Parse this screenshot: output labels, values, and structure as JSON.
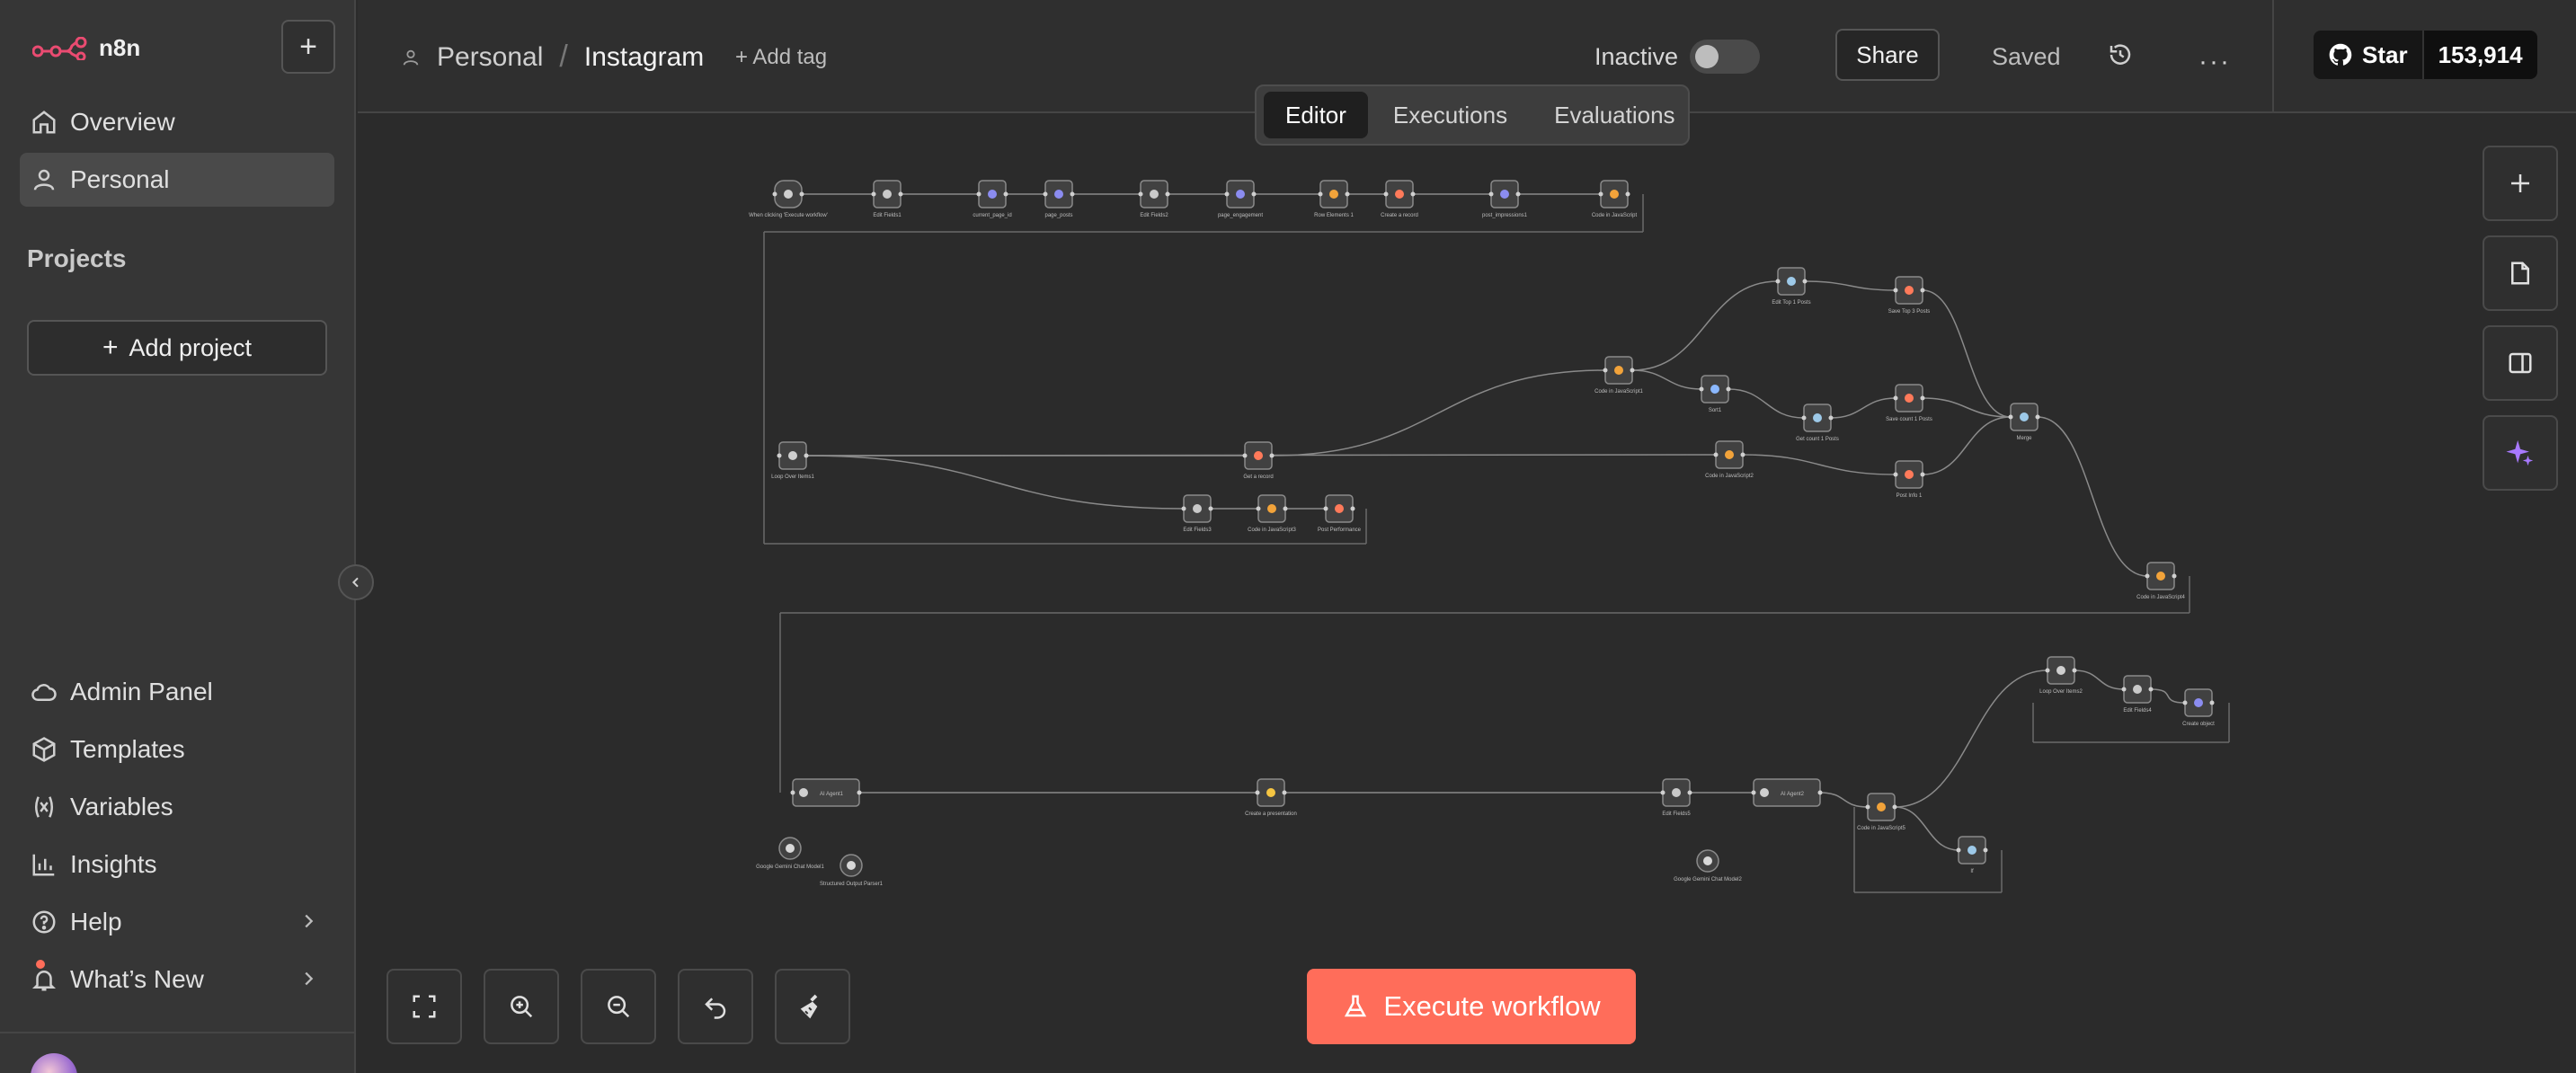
{
  "sidebar": {
    "brand": "n8n",
    "nav": [
      {
        "label": "Overview",
        "icon": "home-icon"
      },
      {
        "label": "Personal",
        "icon": "user-icon"
      }
    ],
    "projects_label": "Projects",
    "add_project_label": "Add project",
    "bottom_nav": [
      {
        "label": "Admin Panel",
        "icon": "cloud-icon"
      },
      {
        "label": "Templates",
        "icon": "box-icon"
      },
      {
        "label": "Variables",
        "icon": "variables-icon"
      },
      {
        "label": "Insights",
        "icon": "chart-icon"
      },
      {
        "label": "Help",
        "icon": "help-icon"
      },
      {
        "label": "What’s New",
        "icon": "bell-icon"
      }
    ]
  },
  "header": {
    "breadcrumb_project": "Personal",
    "breadcrumb_sep": "/",
    "workflow_name": "Instagram",
    "add_tag": "+ Add tag",
    "status_label": "Inactive",
    "share_label": "Share",
    "saved_label": "Saved",
    "github_star": "Star",
    "github_count": "153,914"
  },
  "tabs": [
    "Editor",
    "Executions",
    "Evaluations"
  ],
  "execute_label": "Execute workflow",
  "colors": {
    "accent": "#ff6d5a",
    "sidebar_bg": "#363636",
    "canvas_bg": "#2b2b2b"
  },
  "canvas": {
    "node_labels": [
      "When clicking 'Execute workflow'",
      "Edit Fields1",
      "current_page_id",
      "page_posts",
      "Edit Fields2",
      "page_engagement",
      "Row Elements 1",
      "Create a record",
      "post_impressions1",
      "Code in JavaScript",
      "Edit Top 1 Posts",
      "Save Top 3 Posts",
      "Code in JavaScript1",
      "Sort1",
      "Get count 1 Posts",
      "Save count 1 Posts",
      "Merge",
      "Loop Over Items1",
      "Get a record",
      "Code in JavaScript2",
      "Post Info 1",
      "Edit Fields3",
      "Code in JavaScript3",
      "Post Performance",
      "Code in JavaScript4",
      "Loop Over Items2",
      "Edit Fields4",
      "Create object",
      "AI Agent1",
      "Google Gemini Chat Model1",
      "Structured Output Parser1",
      "Create a presentation",
      "Edit Fields5",
      "AI Agent2",
      "Google Gemini Chat Model2",
      "Code in JavaScript5",
      "If"
    ]
  }
}
